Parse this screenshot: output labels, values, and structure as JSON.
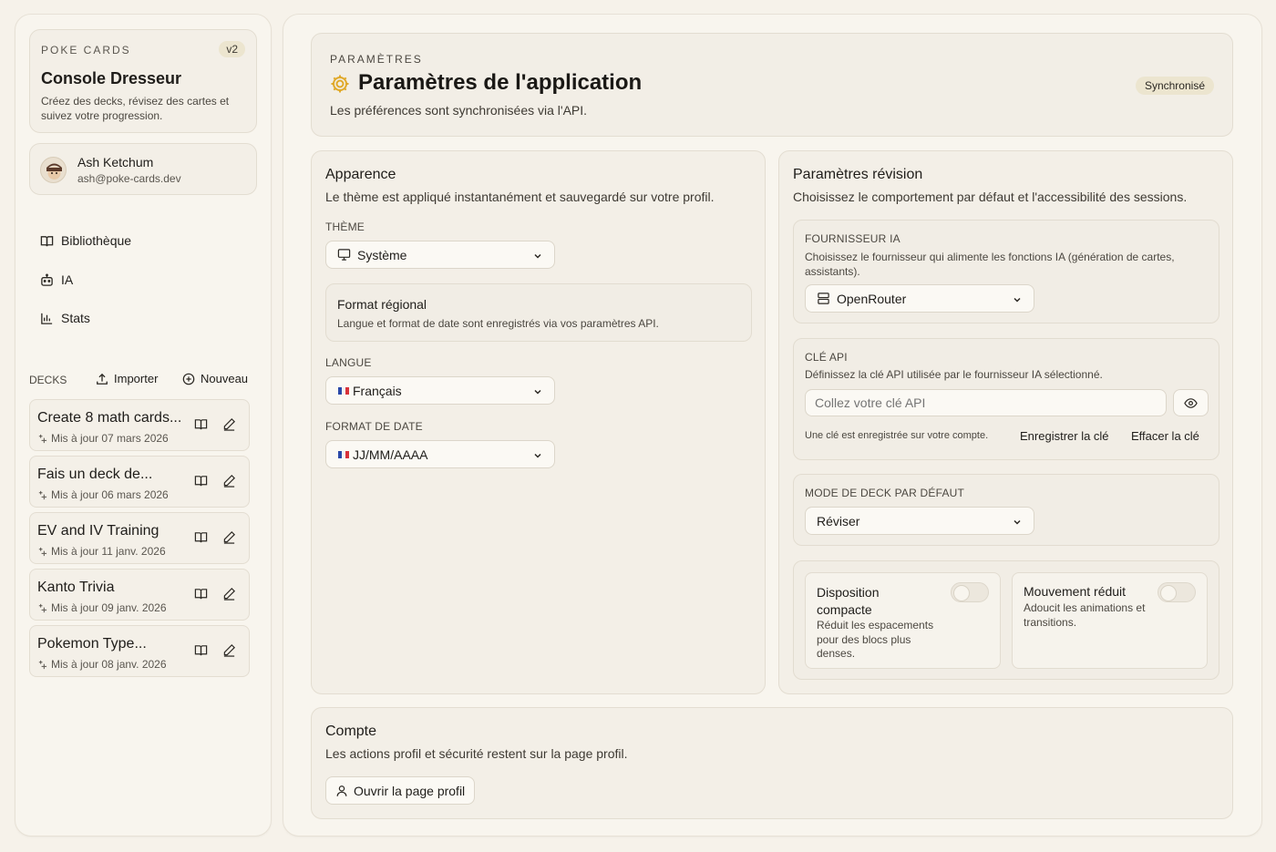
{
  "sidebar": {
    "brand": {
      "kicker": "POKE CARDS",
      "version": "v2",
      "title": "Console Dresseur",
      "subtitle": "Créez des decks, révisez des cartes et suivez votre progression."
    },
    "user": {
      "name": "Ash Ketchum",
      "email": "ash@poke-cards.dev"
    },
    "nav": [
      {
        "label": "Bibliothèque",
        "icon": "book-icon"
      },
      {
        "label": "IA",
        "icon": "bot-icon"
      },
      {
        "label": "Stats",
        "icon": "bar-chart-icon"
      }
    ],
    "decks_label": "DECKS",
    "import_label": "Importer",
    "new_label": "Nouveau",
    "decks": [
      {
        "title": "Create 8 math cards...",
        "updated": "Mis à jour 07 mars 2026"
      },
      {
        "title": "Fais un deck de...",
        "updated": "Mis à jour 06 mars 2026"
      },
      {
        "title": "EV and IV Training",
        "updated": "Mis à jour 11 janv. 2026"
      },
      {
        "title": "Kanto Trivia",
        "updated": "Mis à jour 09 janv. 2026"
      },
      {
        "title": "Pokemon Type...",
        "updated": "Mis à jour 08 janv. 2026"
      }
    ]
  },
  "header": {
    "kicker": "PARAMÈTRES",
    "title": "Paramètres de l'application",
    "subtitle": "Les préférences sont synchronisées via l'API.",
    "badge": "Synchronisé"
  },
  "appearance": {
    "title": "Apparence",
    "subtitle": "Le thème est appliqué instantanément et sauvegardé sur votre profil.",
    "theme_label": "THÈME",
    "theme_value": "Système",
    "regional_title": "Format régional",
    "regional_subtitle": "Langue et format de date sont enregistrés via vos paramètres API.",
    "language_label": "LANGUE",
    "language_value": "Français",
    "date_label": "FORMAT DE DATE",
    "date_value": "JJ/MM/AAAA"
  },
  "review": {
    "title": "Paramètres révision",
    "subtitle": "Choisissez le comportement par défaut et l'accessibilité des sessions.",
    "provider_label": "FOURNISSEUR IA",
    "provider_desc": "Choisissez le fournisseur qui alimente les fonctions IA (génération de cartes, assistants).",
    "provider_value": "OpenRouter",
    "api_label": "CLÉ API",
    "api_desc": "Définissez la clé API utilisée par le fournisseur IA sélectionné.",
    "api_placeholder": "Collez votre clé API",
    "api_note": "Une clé est enregistrée sur votre compte.",
    "api_save": "Enregistrer la clé",
    "api_clear": "Effacer la clé",
    "mode_label": "MODE DE DECK PAR DÉFAUT",
    "mode_value": "Réviser",
    "compact_title": "Disposition compacte",
    "compact_desc": "Réduit les espacements pour des blocs plus denses.",
    "compact_on": false,
    "motion_title": "Mouvement réduit",
    "motion_desc": "Adoucit les animations et transitions.",
    "motion_on": false
  },
  "account": {
    "title": "Compte",
    "subtitle": "Les actions profil et sécurité restent sur la page profil.",
    "button": "Ouvrir la page profil"
  },
  "colors": {
    "accent": "#e0a92a",
    "background": "#f6f2ea",
    "badge_bg": "#ece5cf"
  }
}
